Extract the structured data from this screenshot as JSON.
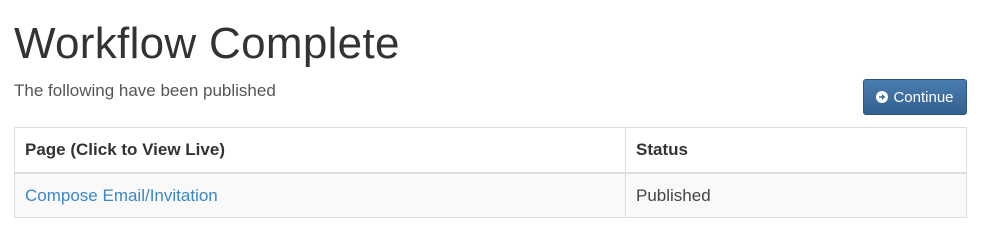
{
  "header": {
    "title": "Workflow Complete",
    "subtitle": "The following have been published"
  },
  "actions": {
    "continue_label": "Continue",
    "continue_icon": "arrow-circle-right-icon"
  },
  "table": {
    "columns": [
      "Page (Click to View Live)",
      "Status"
    ],
    "rows": [
      {
        "page": "Compose Email/Invitation",
        "status": "Published"
      }
    ]
  },
  "colors": {
    "button": "#3a6a9b",
    "link": "#3a87c8",
    "border": "#dddddd"
  }
}
